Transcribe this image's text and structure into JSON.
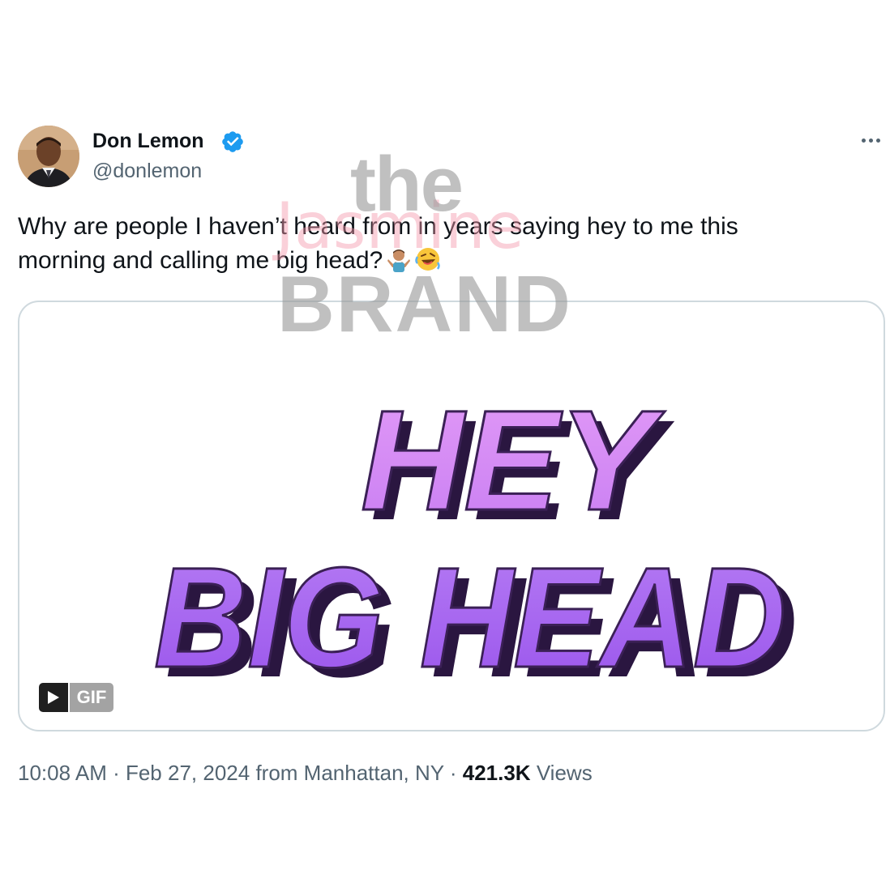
{
  "user": {
    "display_name": "Don Lemon",
    "handle": "@donlemon",
    "verified": true
  },
  "tweet": {
    "text_line1": "Why are people I haven’t heard from in years saying hey to me this",
    "text_line2": "morning and calling me big head?",
    "emojis": [
      "person-shrugging-emoji",
      "rolling-on-floor-laughing-emoji"
    ]
  },
  "media": {
    "gif_text_line1": "HEY",
    "gif_text_line2": "BIG HEAD",
    "badge_label": "GIF"
  },
  "meta": {
    "time": "10:08 AM",
    "separator": " · ",
    "date": "Feb 27, 2024",
    "location": "from Manhattan, NY",
    "views_count": "421.3K",
    "views_label": "Views"
  },
  "watermark": {
    "line1": "the",
    "line2": "Jasmine",
    "line3": "BRAND"
  },
  "colors": {
    "verified_blue": "#1d9bf0",
    "secondary_text": "#536471",
    "border": "#cfd9de",
    "gif_purple_light": "#d98cf5",
    "gif_purple": "#a35ff0"
  }
}
